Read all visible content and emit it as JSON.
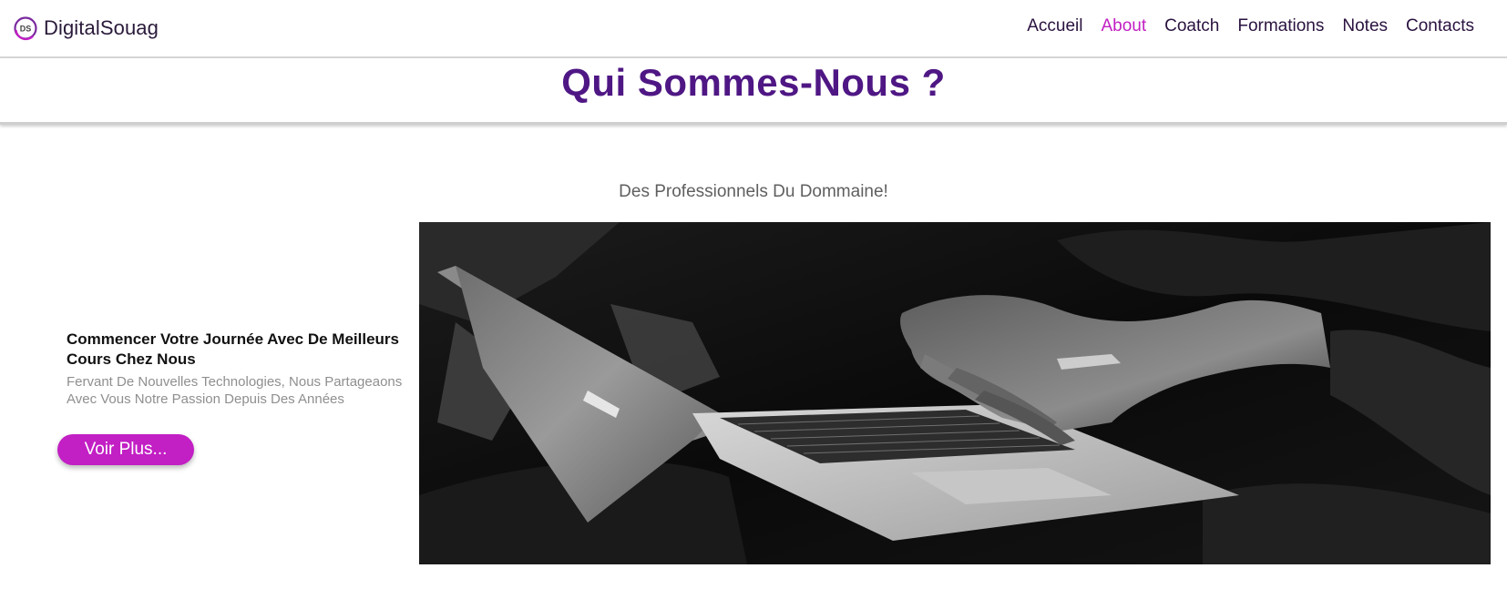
{
  "header": {
    "brand": {
      "logo_icon": "digitalsouag-logo-icon",
      "logo_text": "DS",
      "name": "DigitalSouag"
    },
    "nav": {
      "items": [
        {
          "label": "Accueil",
          "active": false
        },
        {
          "label": "About",
          "active": true
        },
        {
          "label": "Coatch",
          "active": false
        },
        {
          "label": "Formations",
          "active": false
        },
        {
          "label": "Notes",
          "active": false
        },
        {
          "label": "Contacts",
          "active": false
        }
      ]
    }
  },
  "page": {
    "title": "Qui Sommes-Nous ?",
    "subtitle": "Des Professionnels Du Dommaine!"
  },
  "intro": {
    "heading": "Commencer Votre Journée Avec De Meilleurs Cours Chez Nous",
    "text": "Fervant De Nouvelles Technologies, Nous Partageaons Avec Vous Notre Passion Depuis Des Années",
    "button_label": "Voir Plus..."
  },
  "hero_image": {
    "description_icon": "laptop-typing-photo"
  },
  "colors": {
    "accent": "#c21fc4",
    "title": "#4f1784",
    "nav_text": "#2a1240",
    "subtitle": "#5f5f5f",
    "muted_text": "#8f8f8f"
  }
}
